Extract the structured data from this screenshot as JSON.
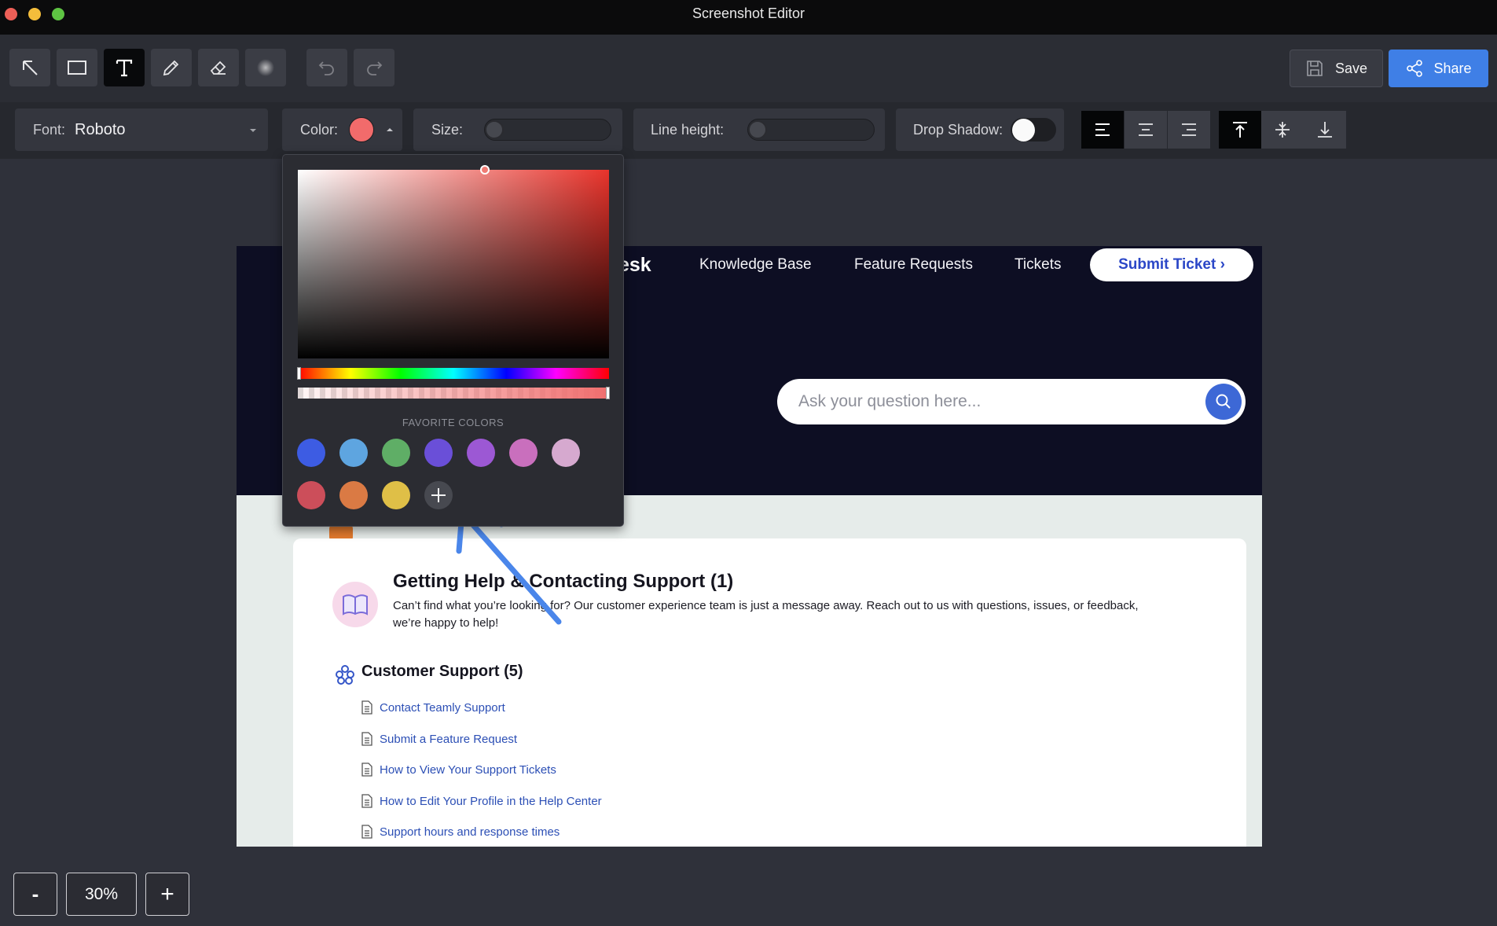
{
  "window": {
    "title": "Screenshot Editor"
  },
  "toolbar": {
    "tools": [
      {
        "name": "arrow-tool",
        "icon": "arrow-icon"
      },
      {
        "name": "rectangle-tool",
        "icon": "rectangle-icon"
      },
      {
        "name": "text-tool",
        "icon": "text-icon",
        "active": true
      },
      {
        "name": "pen-tool",
        "icon": "pen-icon"
      },
      {
        "name": "eraser-tool",
        "icon": "eraser-icon"
      },
      {
        "name": "blur-tool",
        "icon": "blur-icon"
      },
      {
        "name": "undo",
        "icon": "undo-icon"
      },
      {
        "name": "redo",
        "icon": "redo-icon"
      }
    ],
    "save_label": "Save",
    "share_label": "Share"
  },
  "text_options": {
    "font_label": "Font:",
    "font_value": "Roboto",
    "color_label": "Color:",
    "color_value": "#f26b6b",
    "size_label": "Size:",
    "size_level": 0,
    "line_height_label": "Line height:",
    "line_height_level": 0,
    "drop_shadow_label": "Drop Shadow:",
    "drop_shadow_on": false,
    "horizontal_align": [
      "left",
      "center",
      "right"
    ],
    "horizontal_align_selected": "left",
    "vertical_align": [
      "top",
      "middle",
      "bottom"
    ],
    "vertical_align_selected": "top"
  },
  "color_picker": {
    "favorites_title": "FAVORITE COLORS",
    "favorites": [
      "#3d5ce3",
      "#5ea5e0",
      "#5fae66",
      "#6a4fd8",
      "#9c58d4",
      "#c96fbd",
      "#d6a9cf",
      "#cc4e5a",
      "#da7a44",
      "#dfbf47"
    ],
    "add_icon": "plus-icon"
  },
  "canvas": {
    "brand_fragment": "esk",
    "nav": [
      "Knowledge Base",
      "Feature Requests",
      "Tickets"
    ],
    "submit_ticket": "Submit Ticket ›",
    "search_placeholder": "Ask your question here...",
    "section1_title": "Getting Help & Contacting Support (1)",
    "section1_desc1": "Can’t find what you’re looking for? Our customer experience team is just a message away. Reach out to us with questions, issues, or feedback,",
    "section1_desc2": "we’re happy to help!",
    "section2_title": "Customer Support (5)",
    "links": [
      "Contact Teamly Support",
      "Submit a Feature Request",
      "How to View Your Support Tickets",
      "How to Edit Your Profile in the Help Center",
      "Support hours and response times"
    ]
  },
  "zoom": {
    "minus": "-",
    "level": "30%",
    "plus": "+"
  }
}
